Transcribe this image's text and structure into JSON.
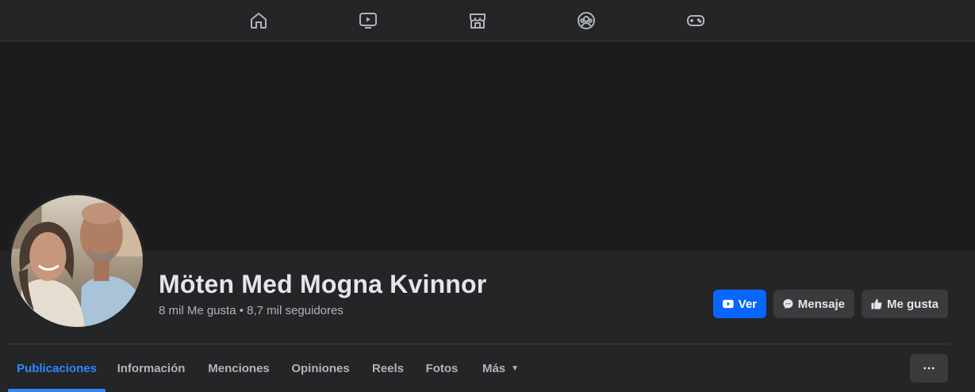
{
  "nav": {
    "icons": [
      "home-icon",
      "watch-icon",
      "marketplace-icon",
      "groups-icon",
      "gaming-icon"
    ]
  },
  "profile": {
    "name": "Möten Med Mogna Kvinnor",
    "stats": "8 mil Me gusta • 8,7 mil seguidores"
  },
  "actions": {
    "watch_label": "Ver",
    "message_label": "Mensaje",
    "like_label": "Me gusta"
  },
  "tabs": [
    {
      "label": "Publicaciones",
      "active": true
    },
    {
      "label": "Información"
    },
    {
      "label": "Menciones"
    },
    {
      "label": "Opiniones"
    },
    {
      "label": "Reels"
    },
    {
      "label": "Fotos"
    },
    {
      "label": "Más"
    }
  ],
  "colors": {
    "accent": "#0866ff",
    "active_tab": "#2d88ff",
    "background": "#242526",
    "cover": "#1c1c1e"
  }
}
